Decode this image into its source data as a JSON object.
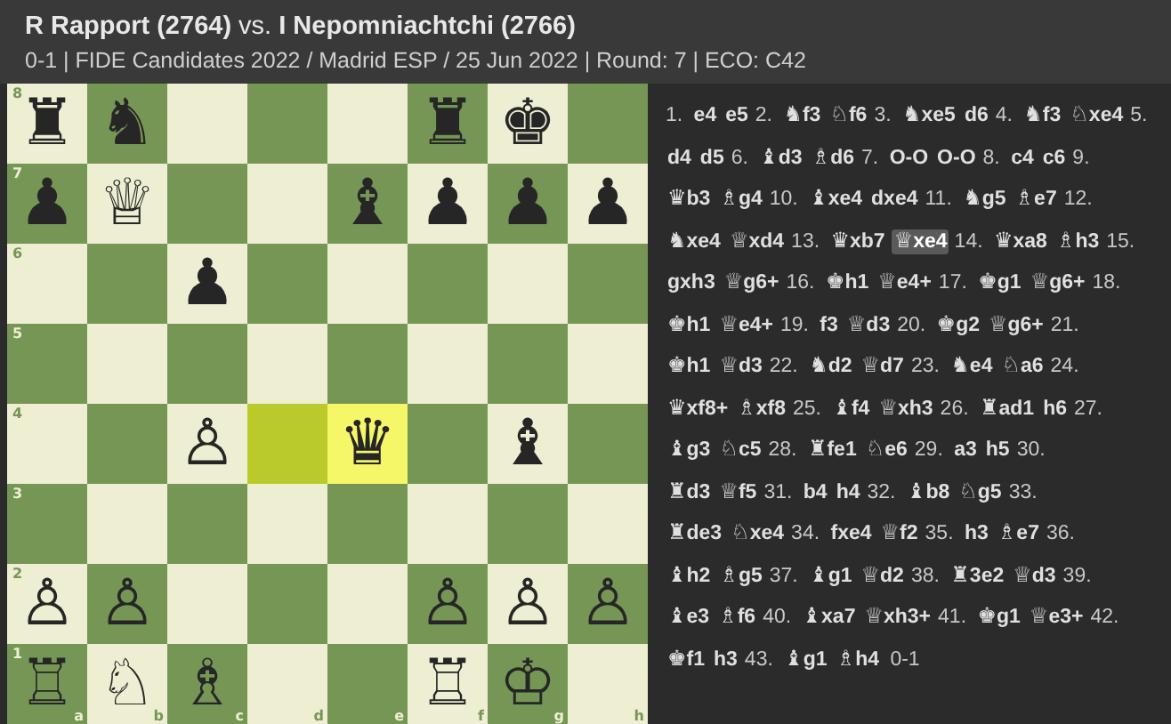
{
  "header": {
    "title": "**R Rapport (2764)** vs. **I Nepomniachtchi (2766)**",
    "subtitle": "0-1 | FIDE Candidates 2022 / Madrid ESP / 25 Jun 2022 | Round: 7 | ECO: C42"
  },
  "board": {
    "files": [
      "a",
      "b",
      "c",
      "d",
      "e",
      "f",
      "g",
      "h"
    ],
    "ranks": [
      {
        "label": "8",
        "squares": [
          {
            "piece": "♜",
            "highlighted": false
          },
          {
            "piece": "♞",
            "highlighted": false
          },
          {
            "highlighted": false
          },
          {
            "highlighted": false
          },
          {
            "highlighted": false
          },
          {
            "piece": "♜",
            "highlighted": false
          },
          {
            "piece": "♚",
            "highlighted": false
          },
          {
            "highlighted": false
          }
        ]
      },
      {
        "label": "7",
        "squares": [
          {
            "piece": "♟",
            "highlighted": false
          },
          {
            "piece": "♕",
            "highlighted": false
          },
          {
            "highlighted": false
          },
          {
            "highlighted": false
          },
          {
            "piece": "♝",
            "highlighted": false
          },
          {
            "piece": "♟",
            "highlighted": false
          },
          {
            "piece": "♟",
            "highlighted": false
          },
          {
            "piece": "♟",
            "highlighted": false
          }
        ]
      },
      {
        "label": "6",
        "squares": [
          {
            "highlighted": false
          },
          {
            "highlighted": false
          },
          {
            "piece": "♟",
            "highlighted": false
          },
          {
            "highlighted": false
          },
          {
            "highlighted": false
          },
          {
            "highlighted": false
          },
          {
            "highlighted": false
          },
          {
            "highlighted": false
          }
        ]
      },
      {
        "label": "5",
        "squares": [
          {
            "highlighted": false
          },
          {
            "highlighted": false
          },
          {
            "highlighted": false
          },
          {
            "highlighted": false
          },
          {
            "highlighted": false
          },
          {
            "highlighted": false
          },
          {
            "highlighted": false
          },
          {
            "highlighted": false
          }
        ]
      },
      {
        "label": "4",
        "squares": [
          {
            "highlighted": false
          },
          {
            "highlighted": false
          },
          {
            "piece": "♙",
            "highlighted": false
          },
          {
            "highlighted": true
          },
          {
            "piece": "♛",
            "highlighted": true
          },
          {
            "highlighted": false
          },
          {
            "piece": "♝",
            "highlighted": false
          },
          {
            "highlighted": false
          }
        ]
      },
      {
        "label": "3",
        "squares": [
          {
            "highlighted": false
          },
          {
            "highlighted": false
          },
          {
            "highlighted": false
          },
          {
            "highlighted": false
          },
          {
            "highlighted": false
          },
          {
            "highlighted": false
          },
          {
            "highlighted": false
          },
          {
            "highlighted": false
          }
        ]
      },
      {
        "label": "2",
        "squares": [
          {
            "piece": "♙",
            "highlighted": false
          },
          {
            "piece": "♙",
            "highlighted": false
          },
          {
            "highlighted": false
          },
          {
            "highlighted": false
          },
          {
            "highlighted": false
          },
          {
            "piece": "♙",
            "highlighted": false
          },
          {
            "piece": "♙",
            "highlighted": false
          },
          {
            "piece": "♙",
            "highlighted": false
          }
        ]
      },
      {
        "label": "1",
        "squares": [
          {
            "piece": "♖",
            "highlighted": false
          },
          {
            "piece": "♘",
            "highlighted": false
          },
          {
            "piece": "♗",
            "highlighted": false
          },
          {
            "highlighted": false
          },
          {
            "highlighted": false
          },
          {
            "piece": "♖",
            "highlighted": false
          },
          {
            "piece": "♔",
            "highlighted": false
          },
          {
            "highlighted": false
          }
        ]
      }
    ]
  },
  "moves": [
    {
      "number": "1.",
      "white": {
        "san": "e4",
        "selected": false
      },
      "black": {
        "san": "e5",
        "selected": false
      }
    },
    {
      "number": "2.",
      "white": {
        "figure": "♞",
        "san": "f3",
        "selected": false
      },
      "black": {
        "figure": "♘",
        "san": "f6",
        "selected": false
      }
    },
    {
      "number": "3.",
      "white": {
        "figure": "♞",
        "san": "xe5",
        "selected": false
      },
      "black": {
        "san": "d6",
        "selected": false
      }
    },
    {
      "number": "4.",
      "white": {
        "figure": "♞",
        "san": "f3",
        "selected": false
      },
      "black": {
        "figure": "♘",
        "san": "xe4",
        "selected": false
      }
    },
    {
      "number": "5.",
      "white": {
        "san": "d4",
        "selected": false
      },
      "black": {
        "san": "d5",
        "selected": false
      }
    },
    {
      "number": "6.",
      "white": {
        "figure": "♝",
        "san": "d3",
        "selected": false
      },
      "black": {
        "figure": "♗",
        "san": "d6",
        "selected": false
      }
    },
    {
      "number": "7.",
      "white": {
        "san": "O-O",
        "selected": false
      },
      "black": {
        "san": "O-O",
        "selected": false
      }
    },
    {
      "number": "8.",
      "white": {
        "san": "c4",
        "selected": false
      },
      "black": {
        "san": "c6",
        "selected": false
      }
    },
    {
      "number": "9.",
      "white": {
        "figure": "♛",
        "san": "b3",
        "selected": false
      },
      "black": {
        "figure": "♗",
        "san": "g4",
        "selected": false
      }
    },
    {
      "number": "10.",
      "white": {
        "figure": "♝",
        "san": "xe4",
        "selected": false
      },
      "black": {
        "san": "dxe4",
        "selected": false
      }
    },
    {
      "number": "11.",
      "white": {
        "figure": "♞",
        "san": "g5",
        "selected": false
      },
      "black": {
        "figure": "♗",
        "san": "e7",
        "selected": false
      }
    },
    {
      "number": "12.",
      "white": {
        "figure": "♞",
        "san": "xe4",
        "selected": false
      },
      "black": {
        "figure": "♕",
        "san": "xd4",
        "selected": false
      }
    },
    {
      "number": "13.",
      "white": {
        "figure": "♛",
        "san": "xb7",
        "selected": false
      },
      "black": {
        "figure": "♕",
        "san": "xe4",
        "selected": true
      }
    },
    {
      "number": "14.",
      "white": {
        "figure": "♛",
        "san": "xa8",
        "selected": false
      },
      "black": {
        "figure": "♗",
        "san": "h3",
        "selected": false
      }
    },
    {
      "number": "15.",
      "white": {
        "san": "gxh3",
        "selected": false
      },
      "black": {
        "figure": "♕",
        "san": "g6+",
        "selected": false
      }
    },
    {
      "number": "16.",
      "white": {
        "figure": "♚",
        "san": "h1",
        "selected": false
      },
      "black": {
        "figure": "♕",
        "san": "e4+",
        "selected": false
      }
    },
    {
      "number": "17.",
      "white": {
        "figure": "♚",
        "san": "g1",
        "selected": false
      },
      "black": {
        "figure": "♕",
        "san": "g6+",
        "selected": false
      }
    },
    {
      "number": "18.",
      "white": {
        "figure": "♚",
        "san": "h1",
        "selected": false
      },
      "black": {
        "figure": "♕",
        "san": "e4+",
        "selected": false
      }
    },
    {
      "number": "19.",
      "white": {
        "san": "f3",
        "selected": false
      },
      "black": {
        "figure": "♕",
        "san": "d3",
        "selected": false
      }
    },
    {
      "number": "20.",
      "white": {
        "figure": "♚",
        "san": "g2",
        "selected": false
      },
      "black": {
        "figure": "♕",
        "san": "g6+",
        "selected": false
      }
    },
    {
      "number": "21.",
      "white": {
        "figure": "♚",
        "san": "h1",
        "selected": false
      },
      "black": {
        "figure": "♕",
        "san": "d3",
        "selected": false
      }
    },
    {
      "number": "22.",
      "white": {
        "figure": "♞",
        "san": "d2",
        "selected": false
      },
      "black": {
        "figure": "♕",
        "san": "d7",
        "selected": false
      }
    },
    {
      "number": "23.",
      "white": {
        "figure": "♞",
        "san": "e4",
        "selected": false
      },
      "black": {
        "figure": "♘",
        "san": "a6",
        "selected": false
      }
    },
    {
      "number": "24.",
      "white": {
        "figure": "♛",
        "san": "xf8+",
        "selected": false
      },
      "black": {
        "figure": "♗",
        "san": "xf8",
        "selected": false
      }
    },
    {
      "number": "25.",
      "white": {
        "figure": "♝",
        "san": "f4",
        "selected": false
      },
      "black": {
        "figure": "♕",
        "san": "xh3",
        "selected": false
      }
    },
    {
      "number": "26.",
      "white": {
        "figure": "♜",
        "san": "ad1",
        "selected": false
      },
      "black": {
        "san": "h6",
        "selected": false
      }
    },
    {
      "number": "27.",
      "white": {
        "figure": "♝",
        "san": "g3",
        "selected": false
      },
      "black": {
        "figure": "♘",
        "san": "c5",
        "selected": false
      }
    },
    {
      "number": "28.",
      "white": {
        "figure": "♜",
        "san": "fe1",
        "selected": false
      },
      "black": {
        "figure": "♘",
        "san": "e6",
        "selected": false
      }
    },
    {
      "number": "29.",
      "white": {
        "san": "a3",
        "selected": false
      },
      "black": {
        "san": "h5",
        "selected": false
      }
    },
    {
      "number": "30.",
      "white": {
        "figure": "♜",
        "san": "d3",
        "selected": false
      },
      "black": {
        "figure": "♕",
        "san": "f5",
        "selected": false
      }
    },
    {
      "number": "31.",
      "white": {
        "san": "b4",
        "selected": false
      },
      "black": {
        "san": "h4",
        "selected": false
      }
    },
    {
      "number": "32.",
      "white": {
        "figure": "♝",
        "san": "b8",
        "selected": false
      },
      "black": {
        "figure": "♘",
        "san": "g5",
        "selected": false
      }
    },
    {
      "number": "33.",
      "white": {
        "figure": "♜",
        "san": "de3",
        "selected": false
      },
      "black": {
        "figure": "♘",
        "san": "xe4",
        "selected": false
      }
    },
    {
      "number": "34.",
      "white": {
        "san": "fxe4",
        "selected": false
      },
      "black": {
        "figure": "♕",
        "san": "f2",
        "selected": false
      }
    },
    {
      "number": "35.",
      "white": {
        "san": "h3",
        "selected": false
      },
      "black": {
        "figure": "♗",
        "san": "e7",
        "selected": false
      }
    },
    {
      "number": "36.",
      "white": {
        "figure": "♝",
        "san": "h2",
        "selected": false
      },
      "black": {
        "figure": "♗",
        "san": "g5",
        "selected": false
      }
    },
    {
      "number": "37.",
      "white": {
        "figure": "♝",
        "san": "g1",
        "selected": false
      },
      "black": {
        "figure": "♕",
        "san": "d2",
        "selected": false
      }
    },
    {
      "number": "38.",
      "white": {
        "figure": "♜",
        "san": "3e2",
        "selected": false
      },
      "black": {
        "figure": "♕",
        "san": "d3",
        "selected": false
      }
    },
    {
      "number": "39.",
      "white": {
        "figure": "♝",
        "san": "e3",
        "selected": false
      },
      "black": {
        "figure": "♗",
        "san": "f6",
        "selected": false
      }
    },
    {
      "number": "40.",
      "white": {
        "figure": "♝",
        "san": "xa7",
        "selected": false
      },
      "black": {
        "figure": "♕",
        "san": "xh3+",
        "selected": false
      }
    },
    {
      "number": "41.",
      "white": {
        "figure": "♚",
        "san": "g1",
        "selected": false
      },
      "black": {
        "figure": "♕",
        "san": "e3+",
        "selected": false
      }
    },
    {
      "number": "42.",
      "white": {
        "figure": "♚",
        "san": "f1",
        "selected": false
      },
      "black": {
        "san": "h3",
        "selected": false
      }
    },
    {
      "number": "43.",
      "white": {
        "figure": "♝",
        "san": "g1",
        "selected": false
      },
      "black": {
        "figure": "♗",
        "san": "h4",
        "selected": false
      }
    }
  ],
  "result": "0-1"
}
